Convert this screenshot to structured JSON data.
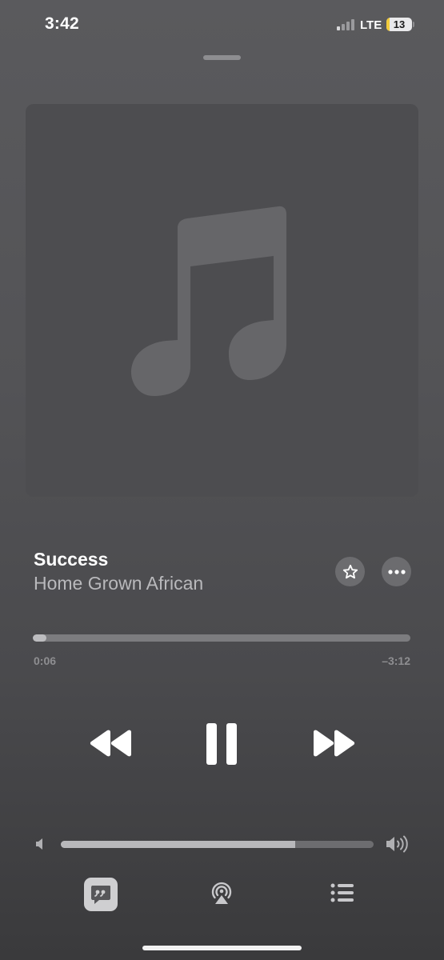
{
  "status_bar": {
    "time": "3:42",
    "network": "LTE",
    "battery_level": "13",
    "battery_color": "#f2cb3b",
    "signal_icon": "cellular-signal-icon"
  },
  "artwork": {
    "placeholder_icon": "music-note-icon",
    "background": "#4d4d50"
  },
  "track": {
    "title": "Success",
    "artist": "Home Grown African",
    "favorite_icon": "star-icon",
    "more_icon": "ellipsis-icon"
  },
  "progress": {
    "elapsed": "0:06",
    "remaining": "–3:12",
    "fraction": 0.035
  },
  "controls": {
    "previous_icon": "rewind-icon",
    "play_pause_icon": "pause-icon",
    "next_icon": "fast-forward-icon"
  },
  "volume": {
    "level": 0.75,
    "low_icon": "speaker-low-icon",
    "high_icon": "speaker-high-icon"
  },
  "bottom_bar": {
    "lyrics_icon": "lyrics-quote-icon",
    "airplay_icon": "airplay-icon",
    "queue_icon": "list-icon"
  }
}
